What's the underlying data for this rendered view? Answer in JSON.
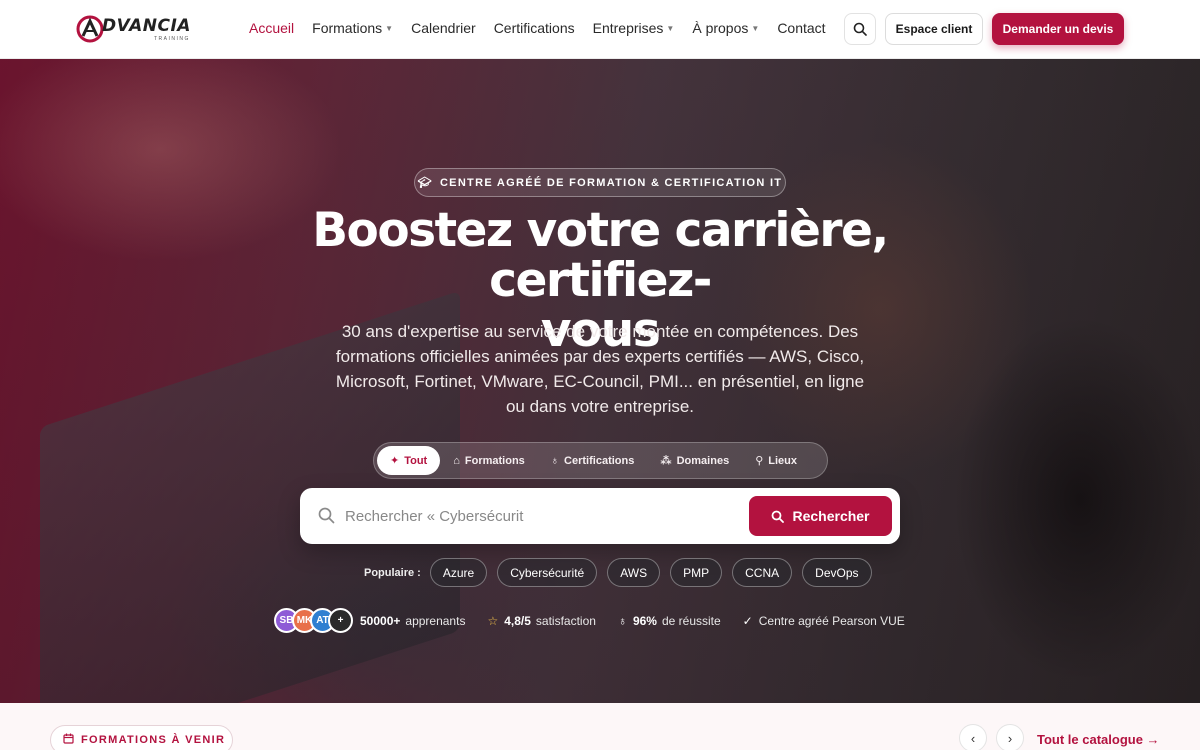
{
  "brand": {
    "name": "DVANCIA",
    "tagline": "TRAINING",
    "accent": "#b3123f"
  },
  "nav": {
    "items": [
      {
        "label": "Accueil",
        "active": true,
        "dropdown": false
      },
      {
        "label": "Formations",
        "active": false,
        "dropdown": true
      },
      {
        "label": "Calendrier",
        "active": false,
        "dropdown": false
      },
      {
        "label": "Certifications",
        "active": false,
        "dropdown": false
      },
      {
        "label": "Entreprises",
        "active": false,
        "dropdown": true
      },
      {
        "label": "À propos",
        "active": false,
        "dropdown": true
      },
      {
        "label": "Contact",
        "active": false,
        "dropdown": false
      }
    ],
    "search_icon": "search-icon",
    "client_label": "Espace client",
    "devis_label": "Demander un devis"
  },
  "hero": {
    "badge": "CENTRE AGRÉÉ DE FORMATION & CERTIFICATION IT",
    "title_line1": "Boostez votre carrière, certifiez-",
    "title_line2": "vous",
    "subtitle": "30 ans d'expertise au service de votre montée en compétences. Des formations officielles animées par des experts certifiés — AWS, Cisco, Microsoft, Fortinet, VMware, EC-Council, PMI... en présentiel, en ligne ou dans votre entreprise.",
    "tabs": [
      {
        "label": "Tout",
        "icon": "sparkle-icon",
        "active": true
      },
      {
        "label": "Formations",
        "icon": "graduation-cap-icon",
        "active": false
      },
      {
        "label": "Certifications",
        "icon": "award-icon",
        "active": false
      },
      {
        "label": "Domaines",
        "icon": "shapes-icon",
        "active": false
      },
      {
        "label": "Lieux",
        "icon": "map-pin-icon",
        "active": false
      }
    ],
    "search": {
      "placeholder": "Rechercher « Cybersécurit",
      "button_label": "Rechercher"
    },
    "popular_label": "Populaire :",
    "popular": [
      "Azure",
      "Cybersécurité",
      "AWS",
      "PMP",
      "CCNA",
      "DevOps"
    ],
    "avatars": [
      {
        "initials": "SB",
        "color": "#8e5bd6"
      },
      {
        "initials": "MK",
        "color": "#e8704a"
      },
      {
        "initials": "AT",
        "color": "#2f7fd1"
      },
      {
        "initials": "+",
        "color": "#2a2a2a"
      }
    ],
    "stats": {
      "learners_value": "50000+",
      "learners_label": "apprenants",
      "rating_value": "4,8/5",
      "rating_label": "satisfaction",
      "success_value": "96%",
      "success_label": "de réussite",
      "pearson_label": "Centre agréé Pearson VUE"
    }
  },
  "upcoming": {
    "label": "FORMATIONS À VENIR",
    "prev": "‹",
    "next": "›",
    "catalog_label": "Tout le catalogue →"
  }
}
